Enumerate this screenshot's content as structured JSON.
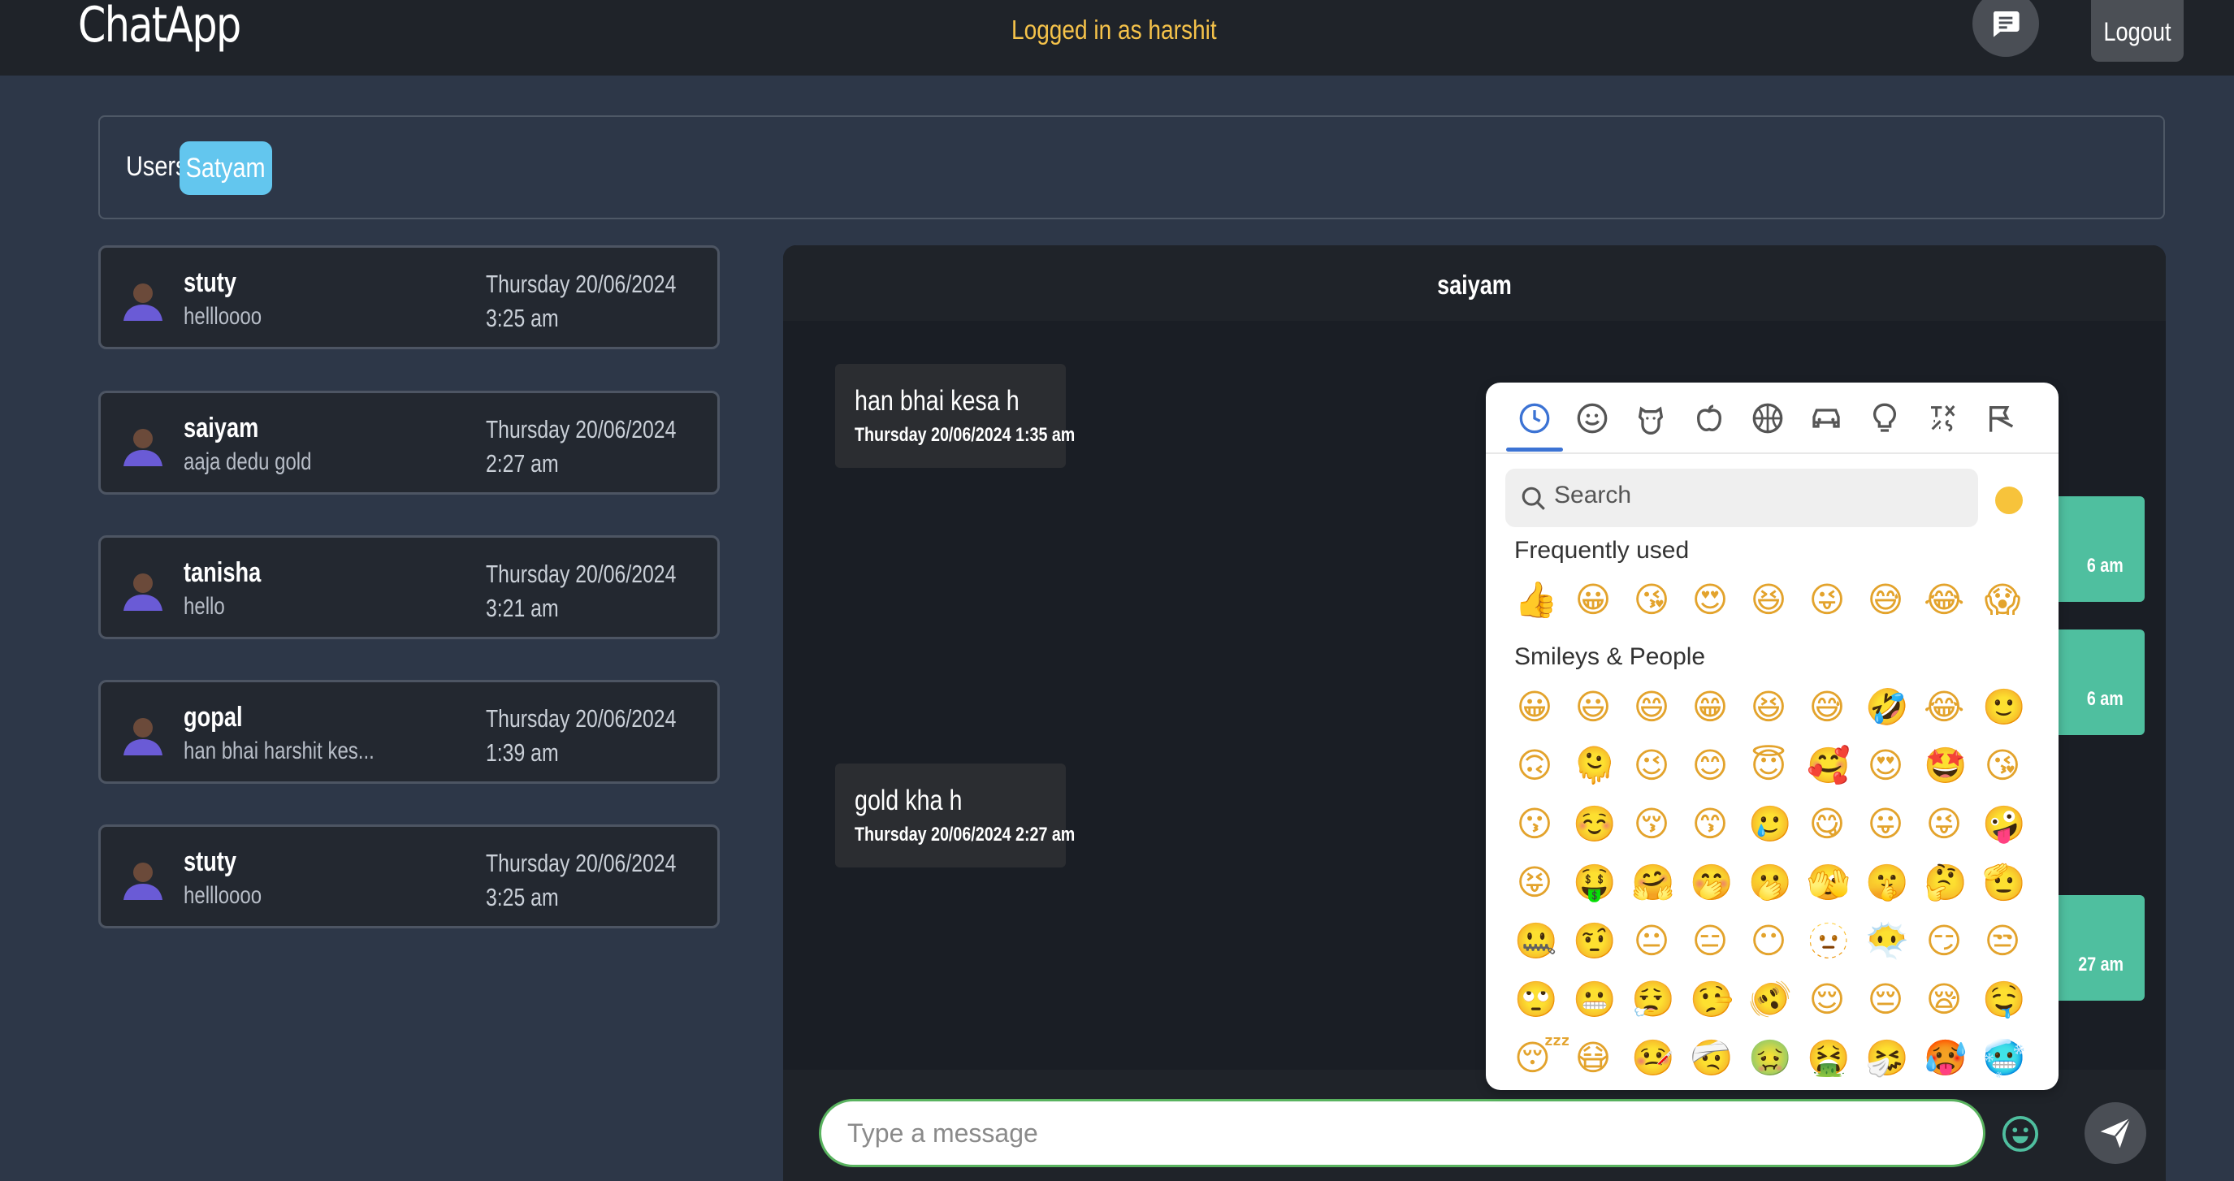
{
  "navbar": {
    "brand": "ChatApp",
    "logged_in": "Logged in as harshit",
    "logout_label": "Logout"
  },
  "users_bar": {
    "label": "Users",
    "active_user": "Satyam"
  },
  "conversations": [
    {
      "name": "stuty",
      "last_message": "hellloooo",
      "date": "Thursday 20/06/2024",
      "time": "3:25 am"
    },
    {
      "name": "saiyam",
      "last_message": "aaja dedu gold",
      "date": "Thursday 20/06/2024",
      "time": "2:27 am"
    },
    {
      "name": "tanisha",
      "last_message": "hello",
      "date": "Thursday 20/06/2024",
      "time": "3:21 am"
    },
    {
      "name": "gopal",
      "last_message": "han bhai harshit kes...",
      "date": "Thursday 20/06/2024",
      "time": "1:39 am"
    },
    {
      "name": "stuty",
      "last_message": "hellloooo",
      "date": "Thursday 20/06/2024",
      "time": "3:25 am"
    }
  ],
  "chat": {
    "title": "saiyam",
    "incoming": [
      {
        "text": "han bhai kesa h",
        "time": "Thursday 20/06/2024 1:35 am"
      },
      {
        "text": "gold kha h",
        "time": "Thursday 20/06/2024 2:27 am"
      }
    ],
    "outgoing_time_fragments": [
      "6 am",
      "6 am",
      "27 am"
    ]
  },
  "composer": {
    "placeholder": "Type a message"
  },
  "emoji_picker": {
    "categories": [
      "recent-icon",
      "smileys-icon",
      "animals-icon",
      "food-icon",
      "activity-icon",
      "travel-icon",
      "objects-icon",
      "symbols-icon",
      "flags-icon"
    ],
    "search_placeholder": "Search",
    "frequently_used_label": "Frequently used",
    "frequently_used": [
      "👍",
      "😀",
      "😘",
      "😍",
      "😆",
      "😜",
      "😅",
      "😂",
      "😱"
    ],
    "smileys_label": "Smileys & People",
    "smileys": [
      "😀",
      "😃",
      "😄",
      "😁",
      "😆",
      "😅",
      "🤣",
      "😂",
      "🙂",
      "🙃",
      "🫠",
      "😉",
      "😊",
      "😇",
      "🥰",
      "😍",
      "🤩",
      "😘",
      "😗",
      "☺️",
      "😚",
      "😙",
      "🥲",
      "😋",
      "😛",
      "😜",
      "🤪",
      "😝",
      "🤑",
      "🤗",
      "🤭",
      "🫢",
      "🫣",
      "🤫",
      "🤔",
      "🫡",
      "🤐",
      "🤨",
      "😐",
      "😑",
      "😶",
      "🫥",
      "😶‍🌫️",
      "😏",
      "😒",
      "🙄",
      "😬",
      "😮‍💨",
      "🤥",
      "🫨",
      "😌",
      "😔",
      "😪",
      "🤤",
      "😴",
      "😷",
      "🤒",
      "🤕",
      "🤢",
      "🤮",
      "🤧",
      "🥵",
      "🥶"
    ],
    "accent_color": "#3c73d4",
    "tone_color": "#f7c33b"
  }
}
